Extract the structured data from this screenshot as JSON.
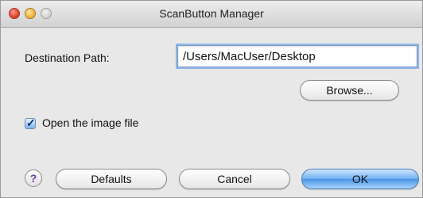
{
  "window": {
    "title": "ScanButton Manager"
  },
  "form": {
    "destination_label": "Destination Path:",
    "destination_value": "/Users/MacUser/Desktop",
    "browse_label": "Browse...",
    "open_image_label": "Open the image file",
    "open_image_checked": true
  },
  "footer": {
    "help_label": "?",
    "defaults_label": "Defaults",
    "cancel_label": "Cancel",
    "ok_label": "OK"
  },
  "colors": {
    "accent": "#6fb0f2",
    "help_icon": "#6f3fb3"
  }
}
